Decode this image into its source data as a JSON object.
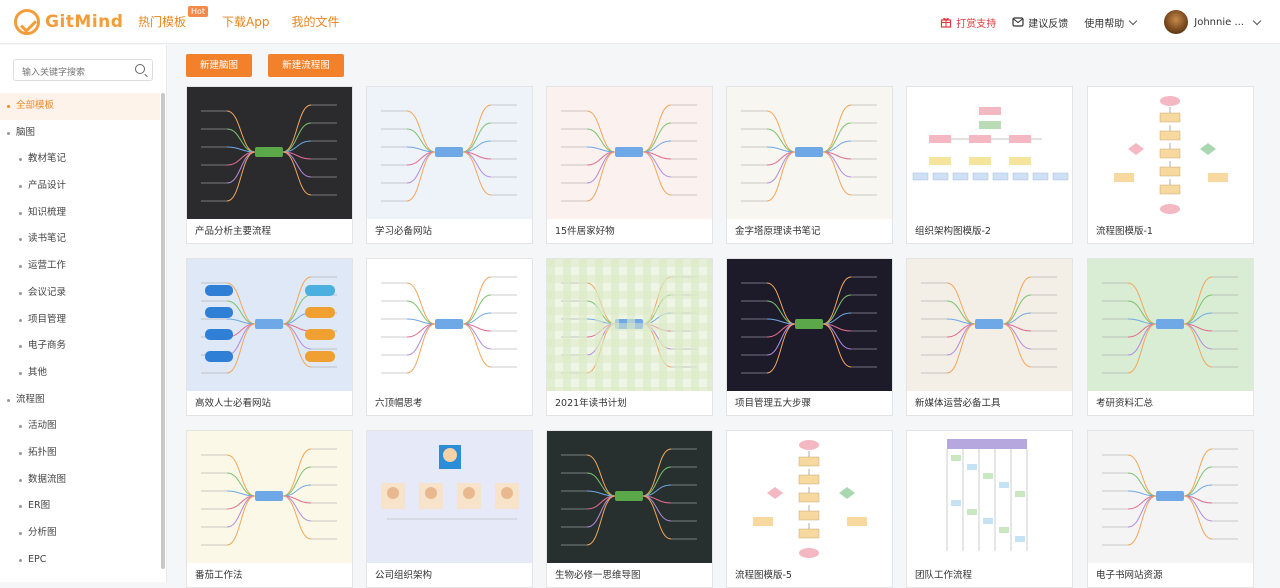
{
  "header": {
    "logo_text": "GitMind",
    "nav": [
      {
        "label": "热门模板",
        "badge": "Hot"
      },
      {
        "label": "下载App"
      },
      {
        "label": "我的文件"
      }
    ],
    "support": "打赏支持",
    "feedback": "建议反馈",
    "help": "使用帮助",
    "username": "Johnnie ..."
  },
  "sidebar": {
    "search_placeholder": "输入关键字搜索",
    "menu": [
      {
        "label": "全部模板",
        "level": 1,
        "active": true
      },
      {
        "label": "脑图",
        "level": 1
      },
      {
        "label": "教材笔记",
        "level": 2
      },
      {
        "label": "产品设计",
        "level": 2
      },
      {
        "label": "知识梳理",
        "level": 2
      },
      {
        "label": "读书笔记",
        "level": 2
      },
      {
        "label": "运营工作",
        "level": 2
      },
      {
        "label": "会议记录",
        "level": 2
      },
      {
        "label": "项目管理",
        "level": 2
      },
      {
        "label": "电子商务",
        "level": 2
      },
      {
        "label": "其他",
        "level": 2
      },
      {
        "label": "流程图",
        "level": 1
      },
      {
        "label": "活动图",
        "level": 2
      },
      {
        "label": "拓扑图",
        "level": 2
      },
      {
        "label": "数据流图",
        "level": 2
      },
      {
        "label": "ER图",
        "level": 2
      },
      {
        "label": "分析图",
        "level": 2
      },
      {
        "label": "EPC",
        "level": 2
      }
    ]
  },
  "toolbar": {
    "new_mindmap": "新建脑图",
    "new_flowchart": "新建流程图"
  },
  "templates": [
    {
      "title": "产品分析主要流程",
      "bg": "#2b2b2e",
      "style": "mind-dark"
    },
    {
      "title": "学习必备网站",
      "bg": "#eef3fa",
      "style": "mind-light"
    },
    {
      "title": "15件居家好物",
      "bg": "#fbf1ef",
      "style": "mind-tree"
    },
    {
      "title": "金字塔原理读书笔记",
      "bg": "#f7f6f1",
      "style": "mind-light"
    },
    {
      "title": "组织架构图模版-2",
      "bg": "#ffffff",
      "style": "org"
    },
    {
      "title": "流程图模版-1",
      "bg": "#ffffff",
      "style": "flow"
    },
    {
      "title": "高效人士必看网站",
      "bg": "#dfe8f7",
      "style": "mind-bubble"
    },
    {
      "title": "六顶帽思考",
      "bg": "#ffffff",
      "style": "mind-tree"
    },
    {
      "title": "2021年读书计划",
      "bg": "#eef5e4",
      "style": "mind-grid"
    },
    {
      "title": "项目管理五大步骤",
      "bg": "#1d1a2a",
      "style": "mind-dark"
    },
    {
      "title": "新媒体运营必备工具",
      "bg": "#f3eee6",
      "style": "mind-color"
    },
    {
      "title": "考研资料汇总",
      "bg": "#d9ecd4",
      "style": "mind-light"
    },
    {
      "title": "番茄工作法",
      "bg": "#fbf8e8",
      "style": "mind-light"
    },
    {
      "title": "公司组织架构",
      "bg": "#e6e9f7",
      "style": "org-avatar"
    },
    {
      "title": "生物必修一思维导图",
      "bg": "#27302e",
      "style": "mind-dark"
    },
    {
      "title": "流程图模版-5",
      "bg": "#ffffff",
      "style": "flow2"
    },
    {
      "title": "团队工作流程",
      "bg": "#ffffff",
      "style": "swim"
    },
    {
      "title": "电子书网站资源",
      "bg": "#f4f4f4",
      "style": "mind-light"
    }
  ]
}
